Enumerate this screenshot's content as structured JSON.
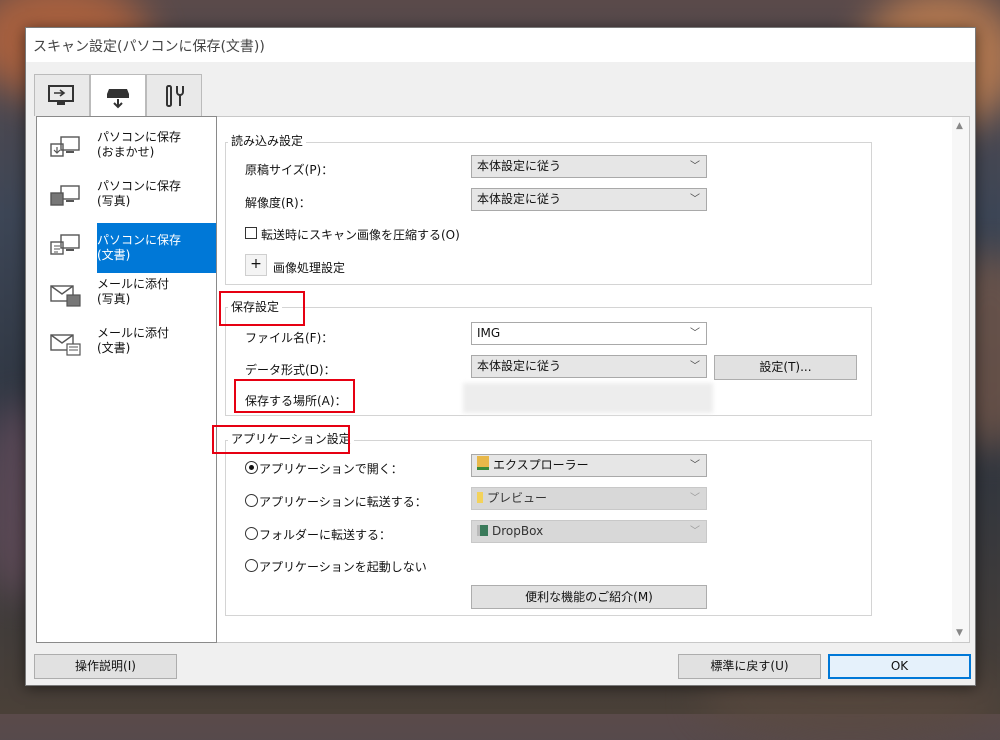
{
  "window": {
    "title": "スキャン設定(パソコンに保存(文書))"
  },
  "tabs": [
    {
      "name": "scan-tab",
      "icon": "pc-scan-icon"
    },
    {
      "name": "device-scan-tab",
      "icon": "scanner-icon"
    },
    {
      "name": "general-settings-tab",
      "icon": "tools-icon"
    }
  ],
  "profiles": [
    {
      "label": "パソコンに保存\n(おまかせ)",
      "icon": "pc-save-icon"
    },
    {
      "label": "パソコンに保存\n(写真)",
      "icon": "pc-save-photo-icon"
    },
    {
      "label": "パソコンに保存\n(文書)",
      "icon": "pc-save-document-icon"
    },
    {
      "label": "メールに添付\n(写真)",
      "icon": "mail-photo-icon"
    },
    {
      "label": "メールに添付\n(文書)",
      "icon": "mail-document-icon"
    }
  ],
  "read_settings": {
    "title": "読み込み設定",
    "paper_size_label": "原稿サイズ(P)：",
    "paper_size_value": "本体設定に従う",
    "resolution_label": "解像度(R)：",
    "resolution_value": "本体設定に従う",
    "compress_label": "転送時にスキャン画像を圧縮する(O)",
    "image_processing_label": "画像処理設定"
  },
  "save_settings": {
    "title": "保存設定",
    "filename_label": "ファイル名(F)：",
    "filename_value": "IMG",
    "format_label": "データ形式(D)：",
    "format_value": "本体設定に従う",
    "format_button": "設定(T)...",
    "location_label": "保存する場所(A)："
  },
  "app_settings": {
    "title": "アプリケーション設定",
    "open_app_label": "アプリケーションで開く：",
    "open_app_value": "エクスプローラー",
    "send_app_label": "アプリケーションに転送する：",
    "send_app_value": "プレビュー",
    "send_folder_label": "フォルダーに転送する：",
    "send_folder_value": "DropBox",
    "no_launch_label": "アプリケーションを起動しない",
    "features_button": "便利な機能のご紹介(M)"
  },
  "footer": {
    "help_button": "操作説明(I)",
    "defaults_button": "標準に戻す(U)",
    "ok_button": "OK"
  },
  "colors": {
    "selection": "#0078d7",
    "highlight_box": "#e60012"
  }
}
